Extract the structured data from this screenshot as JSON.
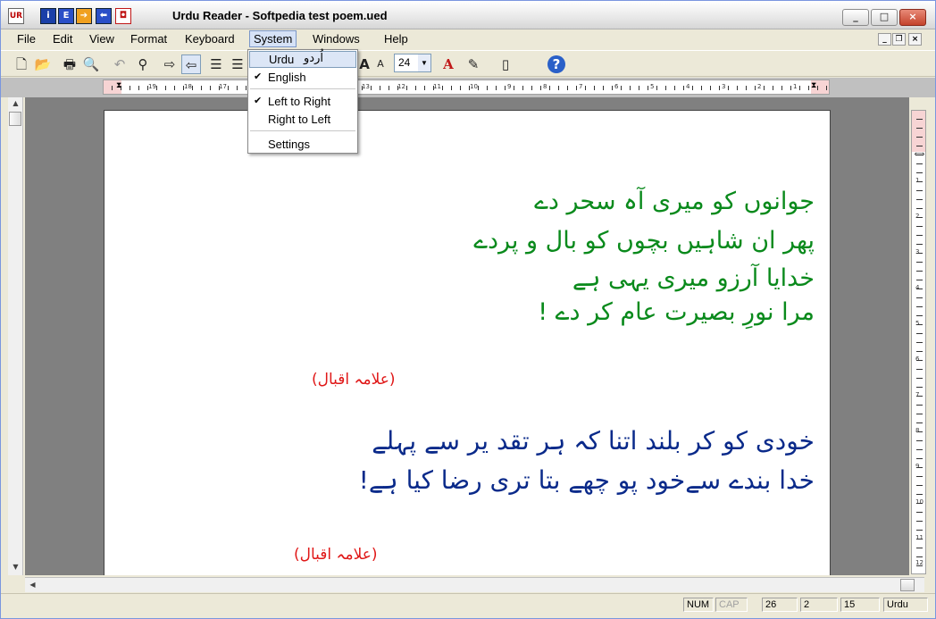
{
  "window": {
    "title": "Urdu Reader - Softpedia test poem.ued",
    "controls": {
      "minimize": "_",
      "maximize": "□",
      "close": "×"
    },
    "mdi_controls": {
      "minimize": "_",
      "restore": "❐",
      "close": "×"
    }
  },
  "quick_icons": [
    {
      "name": "info-icon",
      "glyph": "i",
      "color": "#1a3fa8"
    },
    {
      "name": "english-icon",
      "glyph": "E",
      "color": "#2a4fc8"
    },
    {
      "name": "forward-icon",
      "glyph": "➔",
      "color": "#2060c0"
    },
    {
      "name": "back-icon",
      "glyph": "⬅",
      "color": "#2a4fc8"
    },
    {
      "name": "stop-icon",
      "glyph": "◘",
      "color": "#c01818"
    }
  ],
  "menubar": [
    "File",
    "Edit",
    "View",
    "Format",
    "Keyboard",
    "System",
    "Windows",
    "Help"
  ],
  "toolbar": {
    "font_size": "24",
    "font_size_dropdown": "▼"
  },
  "system_menu": {
    "items": [
      {
        "label": "Urdu",
        "urdu": "اُردو",
        "checked": false,
        "selected": true
      },
      {
        "label": "English",
        "checked": true,
        "selected": false
      },
      {
        "label": "Left  to Right",
        "checked": true,
        "selected": false
      },
      {
        "label": "Right to Left",
        "checked": false,
        "selected": false
      },
      {
        "label": "Settings",
        "checked": false,
        "selected": false
      }
    ],
    "check_glyph": "✔"
  },
  "ruler": {
    "h_numbers": [
      "19",
      "18",
      "17",
      "13",
      "12",
      "11",
      "10",
      "9",
      "8",
      "7",
      "6",
      "5",
      "4",
      "3",
      "2",
      "1"
    ],
    "v_numbers": [
      "1",
      "2",
      "3",
      "4",
      "5",
      "6",
      "7",
      "8",
      "9",
      "10",
      "11",
      "12"
    ]
  },
  "document": {
    "stanza1": [
      "جوانوں کو میری آہ سحر دے",
      "پھر ان شاہیں بچوں کو بال و پردے",
      "خدایا آرزو میری یہی ہے",
      "مرا نورِ بصیرت عام کر دے !"
    ],
    "attribution1": "(علامہ اقبال)",
    "stanza2": [
      "خودی کو کر بلند اتنا کہ ہر تقد یر سے پہلے",
      "خدا بندے سےخود پو چھے بتا تری رضا کیا ہے!"
    ],
    "attribution2": "(علامہ اقبال)",
    "colors": {
      "stanza1": "#0a8a1c",
      "stanza2": "#0a2a8a",
      "attribution": "#e01818"
    }
  },
  "statusbar": {
    "num": "NUM",
    "cap": "CAP",
    "line": "26",
    "col": "2",
    "pos": "15",
    "language": "Urdu"
  }
}
